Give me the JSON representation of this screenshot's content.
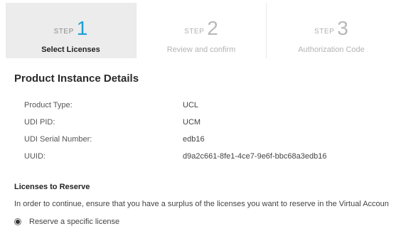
{
  "stepper": {
    "steps": [
      {
        "word": "STEP",
        "number": "1",
        "label": "Select Licenses",
        "active": true
      },
      {
        "word": "STEP",
        "number": "2",
        "label": "Review and confirm",
        "active": false
      },
      {
        "word": "STEP",
        "number": "3",
        "label": "Authorization Code",
        "active": false
      }
    ]
  },
  "details": {
    "title": "Product Instance Details",
    "rows": [
      {
        "key": "Product Type:",
        "value": "UCL"
      },
      {
        "key": "UDI PID:",
        "value": "UCM"
      },
      {
        "key": "UDI Serial Number:",
        "value": "edb16"
      },
      {
        "key": "UUID:",
        "value": "d9a2c661-8fe1-4ce7-9e6f-bbc68a3edb16"
      }
    ]
  },
  "licenses": {
    "heading": "Licenses to Reserve",
    "instruction": "In order to continue, ensure that you have a surplus of the licenses you want to reserve in the Virtual Accoun",
    "option_label": "Reserve a specific license",
    "option_selected": true
  },
  "colors": {
    "accent": "#1ba0d7"
  }
}
